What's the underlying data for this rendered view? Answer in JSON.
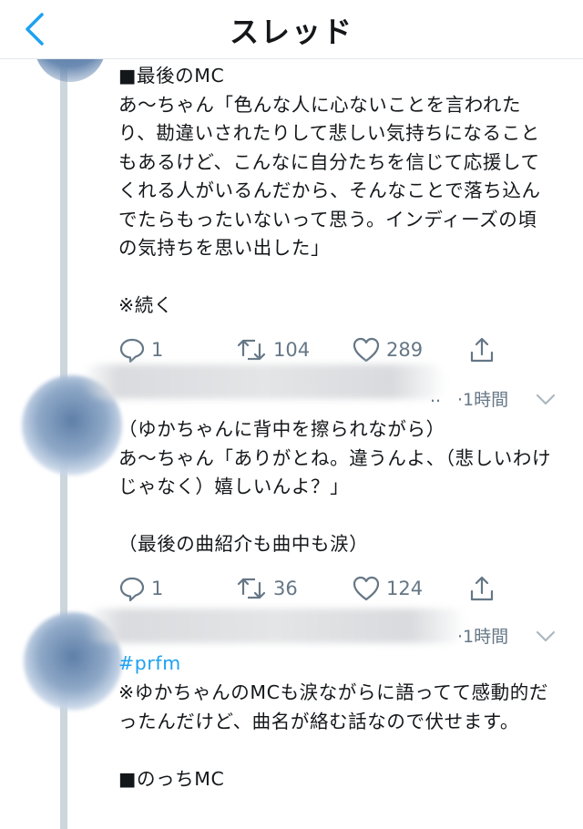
{
  "header": {
    "title": "スレッド"
  },
  "tweets": [
    {
      "text": "■最後のMC\nあ〜ちゃん「色んな人に心ないことを言われたり、勘違いされたりして悲しい気持ちになることもあるけど、こんなに自分たちを信じて応援してくれる人がいるんだから、そんなことで落ち込んでたらもったいないって思う。インディーズの頃の気持ちを思い出した」\n\n※続く",
      "replies": "1",
      "retweets": "104",
      "likes": "289"
    },
    {
      "handle_tail": "..",
      "time": "·1時間",
      "text": "（ゆかちゃんに背中を擦られながら）\nあ〜ちゃん「ありがとね。違うんよ、（悲しいわけじゃなく）嬉しいんよ？」\n\n（最後の曲紹介も曲中も涙）",
      "replies": "1",
      "retweets": "36",
      "likes": "124"
    },
    {
      "time": "·1時間",
      "hashtag": "#prfm",
      "text": "※ゆかちゃんのMCも涙ながらに語ってて感動的だったんだけど、曲名が絡む話なので伏せます。\n\n■のっちMC"
    }
  ]
}
